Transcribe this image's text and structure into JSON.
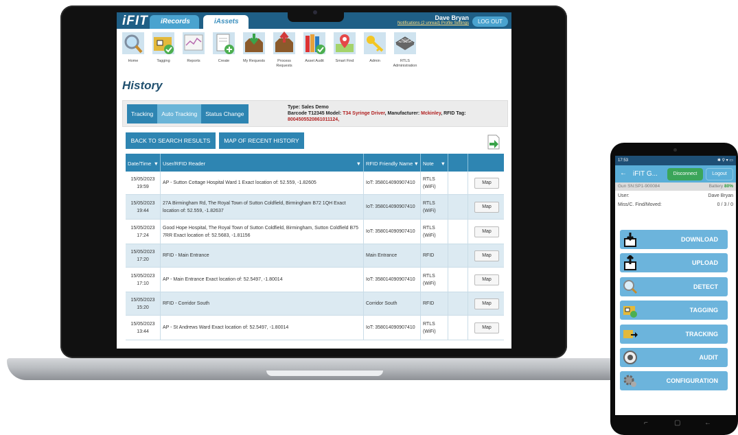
{
  "laptop": {
    "header": {
      "logo": "iFIT",
      "tabs": [
        "iRecords",
        "iAssets"
      ],
      "active_tab": "iAssets",
      "user_name": "Dave Bryan",
      "notifications_link": "Notifications (2 unread)",
      "profile_link": "Profile Settings",
      "logout_label": "LOG OUT"
    },
    "toolbar": [
      {
        "label": "Home",
        "icon": "magnifier-icon"
      },
      {
        "label": "Tagging",
        "icon": "tag-folder-icon"
      },
      {
        "label": "Reports",
        "icon": "chart-icon"
      },
      {
        "label": "Create",
        "icon": "create-doc-icon"
      },
      {
        "label": "My Requests",
        "icon": "box-down-icon"
      },
      {
        "label": "Process Requests",
        "icon": "box-up-icon"
      },
      {
        "label": "Asset Audit",
        "icon": "books-check-icon"
      },
      {
        "label": "Smart Find",
        "icon": "map-pin-icon"
      },
      {
        "label": "Admin",
        "icon": "key-icon"
      },
      {
        "label": "RTLS Administration",
        "icon": "grid-icon"
      }
    ],
    "page_title": "History",
    "view_tabs": [
      "Tracking",
      "Auto Tracking",
      "Status Change"
    ],
    "active_view_tab": "Auto Tracking",
    "asset_meta": {
      "line1": "Type: Sales Demo",
      "barcode_prefix": "Barcode T12345 Model: ",
      "model": "T34 Syringe Driver",
      "manufacturer_prefix": ", Manufacturer: ",
      "manufacturer": "Mckinley",
      "rfid_prefix": ", RFID Tag:",
      "rfid_tag": "8004505520861011124,"
    },
    "buttons": {
      "back": "BACK TO SEARCH RESULTS",
      "map_history": "MAP OF RECENT HISTORY"
    },
    "table": {
      "columns": [
        "Date/Time",
        "User/RFID Reader",
        "RFID Friendly Name",
        "Note",
        "",
        ""
      ],
      "map_label": "Map",
      "rows": [
        {
          "date": "15/05/2023",
          "time": "19:59",
          "reader": "AP - Sutton Cottage Hospital Ward 1 Exact location of: 52.559, -1.82605",
          "friendly": "IoT: 358014090907410",
          "note": "RTLS (WiFi)"
        },
        {
          "date": "15/05/2023",
          "time": "19:44",
          "reader": "27A Birmingham Rd, The Royal Town of Sutton Coldfield, Birmingham B72 1QH Exact location of: 52.559, -1.82637",
          "friendly": "IoT: 358014090907410",
          "note": "RTLS (WiFi)"
        },
        {
          "date": "15/05/2023",
          "time": "17:24",
          "reader": "Good Hope Hospital, The Royal Town of Sutton Coldfield, Birmingham, Sutton Coldfield B75 7RR Exact location of: 52.5683, -1.81156",
          "friendly": "IoT: 358014090907410",
          "note": "RTLS (WiFi)"
        },
        {
          "date": "15/05/2023",
          "time": "17:20",
          "reader": "RFID - Main Entrance",
          "friendly": "Main Entrance",
          "note": "RFID"
        },
        {
          "date": "15/05/2023",
          "time": "17:10",
          "reader": "AP - Main Entrance Exact location of: 52.5497, -1.80014",
          "friendly": "IoT: 358014090907410",
          "note": "RTLS (WiFi)"
        },
        {
          "date": "15/05/2023",
          "time": "15:20",
          "reader": "RFID - Corridor South",
          "friendly": "Corridor South",
          "note": "RFID"
        },
        {
          "date": "15/05/2023",
          "time": "13:44",
          "reader": "AP - St Andrews Ward Exact location of: 52.5497, -1.80014",
          "friendly": "IoT: 358014090907410",
          "note": "RTLS (WiFi)"
        }
      ]
    }
  },
  "phone": {
    "status_time": "17:53",
    "app_title": "iFIT G...",
    "disconnect_label": "Disconnect",
    "logout_label": "Logout",
    "gun_sn": "Gun SN:SP1-900084",
    "battery_label": "Battery",
    "battery_value": "80%",
    "user_label": "User:",
    "user_value": "Dave Bryan",
    "miss_label": "Miss/C. Find/Moved:",
    "miss_value": "0 / 3 / 0",
    "buttons": [
      "DOWNLOAD",
      "UPLOAD",
      "DETECT",
      "TAGGING",
      "TRACKING",
      "AUDIT",
      "CONFIGURATION"
    ]
  },
  "colors": {
    "header_blue": "#1f5f86",
    "accent_blue": "#2e85b2",
    "light_blue": "#6cb4dc",
    "red_text": "#b02020",
    "green": "#3ba55a"
  }
}
